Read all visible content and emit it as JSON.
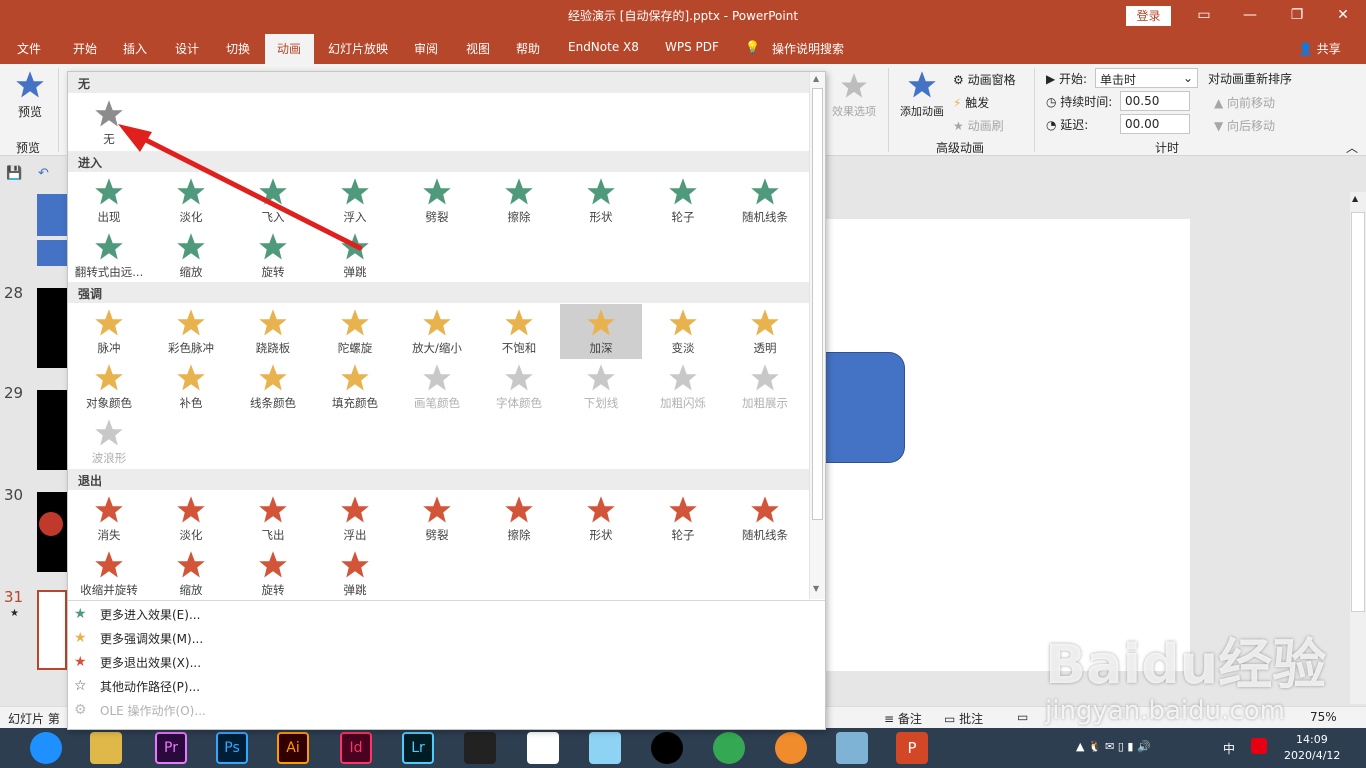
{
  "window": {
    "title": "经验演示 [自动保存的].pptx  -  PowerPoint",
    "login": "登录"
  },
  "tabs": [
    "文件",
    "开始",
    "插入",
    "设计",
    "切换",
    "动画",
    "幻灯片放映",
    "审阅",
    "视图",
    "帮助",
    "EndNote X8",
    "WPS PDF",
    "操作说明搜索",
    "共享"
  ],
  "ribbon": {
    "preview": "预览",
    "preview_group": "预览",
    "effect_options": "效果选项",
    "add_animation": "添加动画",
    "anim_pane": "动画窗格",
    "trigger": "触发",
    "anim_painter": "动画刷",
    "adv_group": "高级动画",
    "start_label": "开始:",
    "start_value": "单击时",
    "duration_label": "持续时间:",
    "duration_value": "00.50",
    "delay_label": "延迟:",
    "delay_value": "00.00",
    "reorder": "对动画重新排序",
    "move_earlier": "向前移动",
    "move_later": "向后移动",
    "timing_group": "计时"
  },
  "gallery": {
    "none_header": "无",
    "none_label": "无",
    "enter_header": "进入",
    "enter": [
      "出现",
      "淡化",
      "飞入",
      "浮入",
      "劈裂",
      "擦除",
      "形状",
      "轮子",
      "随机线条",
      "翻转式由远...",
      "缩放",
      "旋转",
      "弹跳"
    ],
    "emph_header": "强调",
    "emph": [
      "脉冲",
      "彩色脉冲",
      "跷跷板",
      "陀螺旋",
      "放大/缩小",
      "不饱和",
      "加深",
      "变淡",
      "透明",
      "对象颜色",
      "补色",
      "线条颜色",
      "填充颜色",
      "画笔颜色",
      "字体颜色",
      "下划线",
      "加粗闪烁",
      "加粗展示",
      "波浪形"
    ],
    "exit_header": "退出",
    "exit": [
      "消失",
      "淡化",
      "飞出",
      "浮出",
      "劈裂",
      "擦除",
      "形状",
      "轮子",
      "随机线条",
      "收缩并旋转",
      "缩放",
      "旋转",
      "弹跳"
    ],
    "menu": [
      "更多进入效果(E)...",
      "更多强调效果(M)...",
      "更多退出效果(X)...",
      "其他动作路径(P)...",
      "OLE 操作动作(O)..."
    ]
  },
  "slides": {
    "numbers": [
      "28",
      "29",
      "30",
      "31"
    ]
  },
  "status": {
    "slide": "幻灯片 第",
    "notes": "备注",
    "comments": "批注",
    "zoom": "75%"
  },
  "taskbar": {
    "time": "14:09",
    "date": "2020/4/12",
    "ime": "中"
  },
  "watermark": {
    "text": "Baidu经验",
    "url": "jingyan.baidu.com"
  },
  "colors": {
    "accent": "#b7472a",
    "enter": "#4f9a7c",
    "emph": "#e8b34f",
    "exit": "#d2553a"
  }
}
